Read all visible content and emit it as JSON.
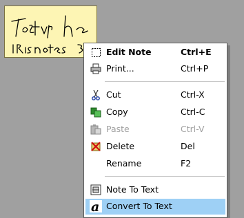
{
  "note": {
    "handwriting_line1": "Testing the",
    "handwriting_line2": "IRISnotes 3"
  },
  "menu": {
    "items": [
      {
        "label": "Edit Note",
        "shortcut": "Ctrl+E",
        "icon": "edit-note-icon"
      },
      {
        "label": "Print...",
        "shortcut": "Ctrl+P",
        "icon": "printer-icon"
      },
      {
        "label": "Cut",
        "shortcut": "Ctrl-X",
        "icon": "scissors-icon"
      },
      {
        "label": "Copy",
        "shortcut": "Ctrl-C",
        "icon": "copy-icon"
      },
      {
        "label": "Paste",
        "shortcut": "Ctrl-V",
        "icon": "paste-icon"
      },
      {
        "label": "Delete",
        "shortcut": "Del",
        "icon": "delete-icon"
      },
      {
        "label": "Rename",
        "shortcut": "F2",
        "icon": ""
      },
      {
        "label": "Note To Text",
        "shortcut": "",
        "icon": "note-to-text-icon"
      },
      {
        "label": "Convert To Text",
        "shortcut": "",
        "icon": "font-a-icon"
      }
    ]
  }
}
